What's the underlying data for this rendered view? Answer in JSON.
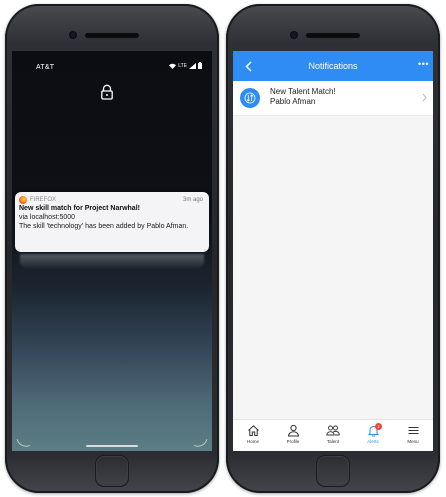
{
  "lock_screen": {
    "carrier": "AT&T",
    "network": "LTE",
    "notification": {
      "app": "FIREFOX",
      "time": "3m ago",
      "title": "New skill match for Project Narwhal!",
      "source": "via localhost:5000",
      "body": "The skill 'technology' has been added by Pablo Afman."
    }
  },
  "app_screen": {
    "header": {
      "title": "Notifications",
      "more_label": "•••"
    },
    "notifications": [
      {
        "title": "New Talent Match!",
        "subtitle": "Pablo Afman"
      }
    ],
    "tabs": [
      {
        "label": "Home",
        "icon": "home-icon",
        "active": false
      },
      {
        "label": "Profile",
        "icon": "profile-icon",
        "active": false
      },
      {
        "label": "Talent",
        "icon": "talent-icon",
        "active": false
      },
      {
        "label": "Alerts",
        "icon": "bell-icon",
        "active": true,
        "badge": "1"
      },
      {
        "label": "Menu",
        "icon": "menu-icon",
        "active": false
      }
    ]
  },
  "colors": {
    "accent": "#2f8cf2",
    "badge": "#f04438"
  }
}
